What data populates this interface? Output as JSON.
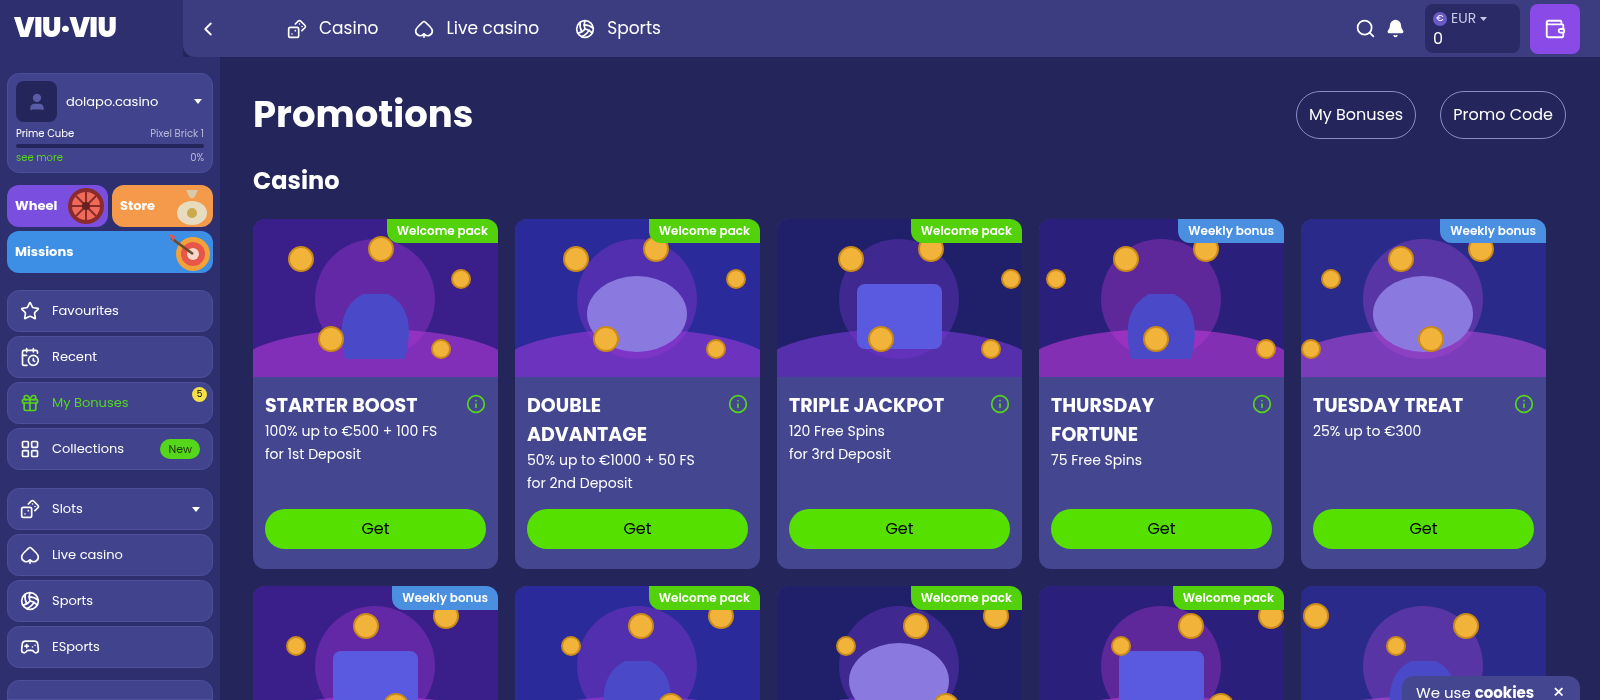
{
  "logo": {
    "text": "VIU·VIU"
  },
  "header": {
    "nav": [
      {
        "label": "Casino",
        "kind": "casino"
      },
      {
        "label": "Live casino",
        "kind": "live"
      },
      {
        "label": "Sports",
        "kind": "sports"
      }
    ],
    "currency_symbol": "€",
    "currency": "EUR",
    "balance": "0"
  },
  "profile": {
    "username": "dolapo.casino",
    "level_name": "Prime Cube",
    "next_level": "Pixel Brick 1",
    "level": 0,
    "see_more": "see more",
    "percent": "0%"
  },
  "tiles": [
    {
      "label": "Wheel",
      "kind": "wheel"
    },
    {
      "label": "Store",
      "kind": "store"
    },
    {
      "label": "Missions",
      "kind": "missions"
    }
  ],
  "sidebar": {
    "groups": [
      [
        {
          "label": "Favourites",
          "kind": "star",
          "selected": false
        },
        {
          "label": "Recent",
          "kind": "recent",
          "selected": false
        },
        {
          "label": "My Bonuses",
          "kind": "gift",
          "selected": true,
          "count": "5"
        },
        {
          "label": "Collections",
          "kind": "collections",
          "selected": false,
          "tag": "New"
        }
      ],
      [
        {
          "label": "Slots",
          "kind": "slots",
          "selected": false,
          "expandable": true
        },
        {
          "label": "Live casino",
          "kind": "cards",
          "selected": false
        },
        {
          "label": "Sports",
          "kind": "ball",
          "selected": false
        },
        {
          "label": "ESports",
          "kind": "gamepad",
          "selected": false
        }
      ]
    ]
  },
  "page": {
    "title": "Promotions",
    "buttons": [
      "My Bonuses",
      "Promo Code"
    ],
    "section": "Casino"
  },
  "promotions": [
    {
      "badge": "Welcome pack",
      "kind": "welcome",
      "title": "STARTER BOOST",
      "lines": [
        "100% up to €500 + 100 FS",
        "for 1st Deposit"
      ],
      "button": "Get"
    },
    {
      "badge": "Welcome pack",
      "kind": "welcome",
      "title": "DOUBLE ADVANTAGE",
      "lines": [
        "50% up to €1000 + 50 FS",
        "for 2nd Deposit"
      ],
      "button": "Get"
    },
    {
      "badge": "Welcome pack",
      "kind": "welcome",
      "title": "TRIPLE JACKPOT",
      "lines": [
        "120 Free Spins",
        "for 3rd Deposit"
      ],
      "button": "Get"
    },
    {
      "badge": "Weekly bonus",
      "kind": "weekly",
      "title": "THURSDAY FORTUNE",
      "lines": [
        "75 Free Spins"
      ],
      "button": "Get"
    },
    {
      "badge": "Weekly bonus",
      "kind": "weekly",
      "title": "TUESDAY TREAT",
      "lines": [
        "25% up to €300"
      ],
      "button": "Get"
    },
    {
      "badge": "Weekly bonus",
      "kind": "weekly"
    },
    {
      "badge": "Welcome pack",
      "kind": "welcome"
    },
    {
      "badge": "Welcome pack",
      "kind": "welcome"
    },
    {
      "badge": "Welcome pack",
      "kind": "welcome"
    },
    {
      "kind": "picture"
    }
  ],
  "cookie": {
    "text": "We use **cookies**",
    "close": "×"
  }
}
